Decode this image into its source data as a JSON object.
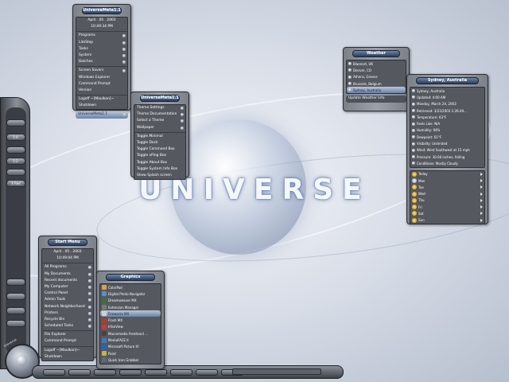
{
  "colors": {
    "accent": "#2a3c58",
    "panel": "#8a8e96",
    "dark": "#55595f"
  },
  "logo_text": "UNIVERSE",
  "menu_top": {
    "caption": "UniverseMeta1.1",
    "date": "April . 05 . 2003",
    "time": "10:49:34 PM",
    "items": [
      "Programs",
      "LiteStep",
      "Tasks",
      "System",
      "Batches"
    ],
    "items2": [
      "Screen Savers",
      "Windows Explorer",
      "Command Prompt",
      "Version"
    ],
    "items3": [
      "Logoff   ~[Maulkan]~",
      "Shutdown"
    ],
    "selected": "UniverseMeta1.1"
  },
  "menu_theme": {
    "caption": "UniverseMeta1.1",
    "items": [
      "Theme Settings",
      "Theme Documentation",
      "Select a Theme",
      "Wallpaper"
    ],
    "items2": [
      "Toggle Minimal",
      "Toggle Dock",
      "Toggle Command Box",
      "Toggle xPing Box",
      "Toggle About Box",
      "Toggle System Info Box",
      "Show Splash screen"
    ]
  },
  "weather_list": {
    "caption": "Weather",
    "items": [
      "Blaenort, UK",
      "Denver, CO",
      "Athens, Greece",
      "Brussels, Belgium",
      "Sydney, Australia"
    ],
    "update": "Update Weather Info"
  },
  "weather_detail": {
    "caption": "Sydney, Australia",
    "items": [
      "Sydney, Australia",
      "Updated: 4:00 AM",
      "Monday, March 24, 2003",
      "Retrieved: 3/23/2003 1:26:49...",
      "Temperature: 63°F",
      "Feels Like: N/A",
      "Humidity: 94%",
      "Dewpoint: 61°F",
      "Visibility: Unlimited",
      "Wind: West Southwest at 15 mph",
      "Pressure: 30.06 inches, falling",
      "Conditions: Mostly Cloudy"
    ],
    "days": [
      "Today",
      "Mon",
      "Tue",
      "Wed",
      "Thu",
      "Fri",
      "Sat",
      "Sun"
    ]
  },
  "start_menu": {
    "caption": "Start Menu",
    "date": "April . 05 . 2003",
    "time": "10:49:04 PM",
    "items": [
      "All Programs",
      "My Documents",
      "Recent documents",
      "My Computer",
      "Control Panel",
      "Admin Tools",
      "Network Neighborhood",
      "Printers",
      "Recycle Bin",
      "Scheduled Tasks"
    ],
    "items2": [
      "File Explorer",
      "Command Prompt"
    ],
    "items3": [
      "Logoff   ~[Maulkan]~",
      "Shutdown"
    ]
  },
  "graphics_menu": {
    "caption": "Graphics",
    "items": [
      "ColorPad",
      "Digital Photo Navigator",
      "Dreamweaver MX",
      "Extension Manager",
      "Fireworks MX",
      "Flash MX",
      "IrfanView",
      "Macromedia FreeHand ...",
      "MediaFACE II",
      "Microsoft Picture It!",
      "Paint",
      "Quick Icon Grabber"
    ],
    "selected_index": 4,
    "icon_colors": [
      "#d6a24a",
      "#5c8bd1",
      "#3f6f3a",
      "#7a7a7a",
      "#d1d1d1",
      "#b33a2a",
      "#c93a3a",
      "#444",
      "#3b7ac4",
      "#2f62b0",
      "#c2b348",
      "#5e6b7a"
    ]
  },
  "left_dock": {
    "labels": [
      "",
      "1:4:",
      "",
      "1:2:",
      "",
      "4 Red"
    ],
    "caption": "Universe"
  }
}
